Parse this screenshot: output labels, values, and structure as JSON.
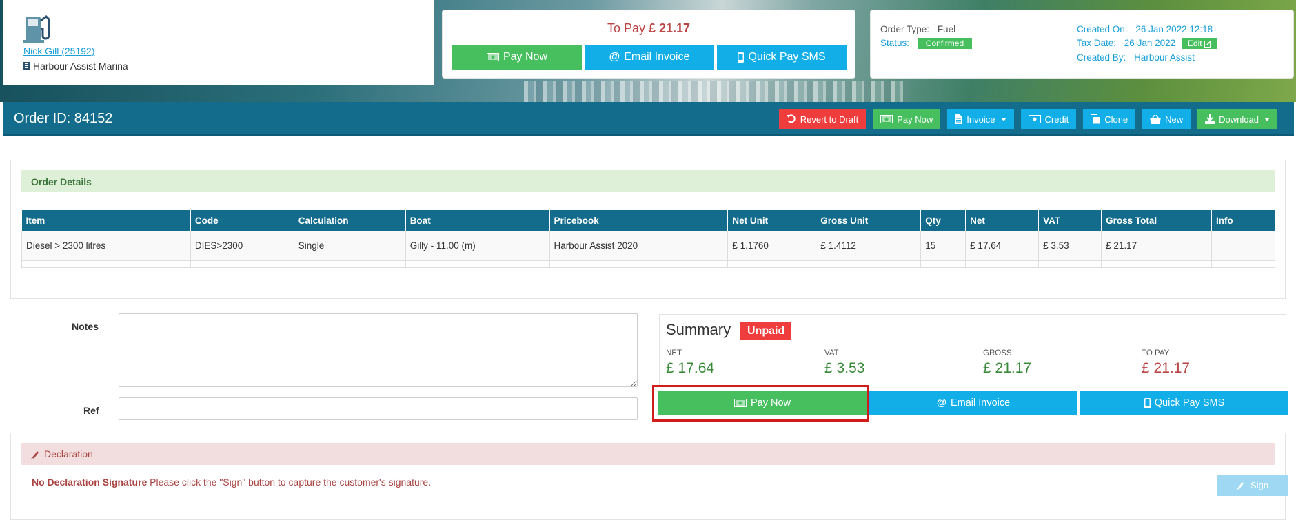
{
  "customer": {
    "name_link": "Nick Gill (25192)",
    "marina": "Harbour Assist Marina"
  },
  "payment_header": {
    "to_pay_label": "To Pay",
    "to_pay_amount": "£ 21.17",
    "pay_now": "Pay Now",
    "email_invoice": "Email Invoice",
    "quick_pay_sms": "Quick Pay SMS"
  },
  "meta": {
    "order_type_label": "Order Type:",
    "order_type_value": "Fuel",
    "status_label": "Status:",
    "status_value": "Confirmed",
    "created_on_label": "Created On:",
    "created_on_value": "26 Jan 2022 12:18",
    "tax_date_label": "Tax Date:",
    "tax_date_value": "26 Jan 2022",
    "edit_label": "Edit",
    "created_by_label": "Created By:",
    "created_by_value": "Harbour Assist"
  },
  "order_bar": {
    "title": "Order ID: 84152",
    "actions": {
      "revert": "Revert to Draft",
      "pay_now": "Pay Now",
      "invoice": "Invoice",
      "credit": "Credit",
      "clone": "Clone",
      "new": "New",
      "download": "Download"
    }
  },
  "order_details": {
    "header": "Order Details",
    "columns": [
      "Item",
      "Code",
      "Calculation",
      "Boat",
      "Pricebook",
      "Net Unit",
      "Gross Unit",
      "Qty",
      "Net",
      "VAT",
      "Gross Total",
      "Info"
    ],
    "rows": [
      [
        "Diesel > 2300 litres",
        "DIES>2300",
        "Single",
        "Gilly - 11.00 (m)",
        "Harbour Assist 2020",
        "£ 1.1760",
        "£ 1.4112",
        "15",
        "£ 17.64",
        "£ 3.53",
        "£ 21.17",
        ""
      ]
    ]
  },
  "form": {
    "notes_label": "Notes",
    "ref_label": "Ref"
  },
  "summary": {
    "title": "Summary",
    "badge": "Unpaid",
    "net_label": "NET",
    "net_value": "£ 17.64",
    "vat_label": "VAT",
    "vat_value": "£ 3.53",
    "gross_label": "GROSS",
    "gross_value": "£ 21.17",
    "to_pay_label": "TO PAY",
    "to_pay_value": "£ 21.17",
    "pay_now": "Pay Now",
    "email_invoice": "Email Invoice",
    "quick_pay_sms": "Quick Pay SMS"
  },
  "declaration": {
    "header": "Declaration",
    "no_signature": "No Declaration Signature",
    "message": "Please click the \"Sign\" button to capture the customer's signature.",
    "sign": "Sign"
  },
  "colors": {
    "primary": "#146c8c",
    "green": "#48bf5f",
    "blue": "#11aee8",
    "red": "#ef3d3d",
    "highlight": "#d11c1c"
  }
}
